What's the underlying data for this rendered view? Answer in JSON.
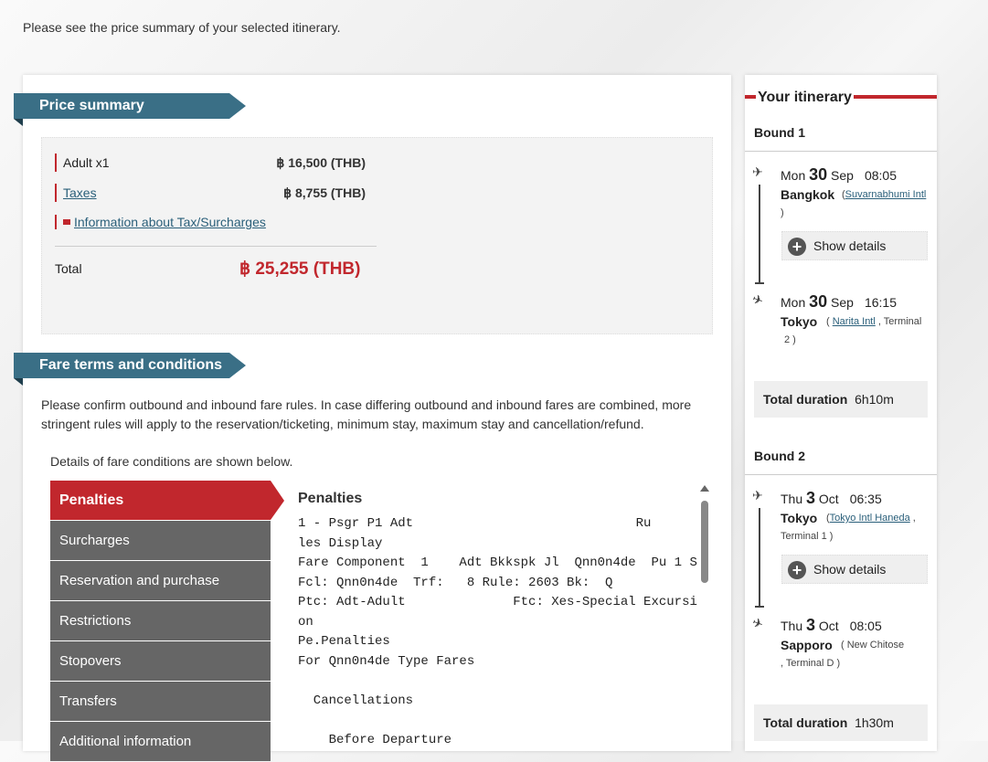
{
  "intro": "Please see the price summary of your selected itinerary.",
  "price_summary": {
    "heading": "Price summary",
    "adult_label": "Adult x1",
    "adult_amount": "฿ 16,500 (THB)",
    "taxes_label": "Taxes",
    "taxes_amount": "฿ 8,755 (THB)",
    "tax_info_link": "Information about Tax/Surcharges",
    "total_label": "Total",
    "total_amount": "฿ 25,255 (THB)"
  },
  "fare_terms": {
    "heading": "Fare terms and conditions",
    "description": "Please confirm outbound and inbound fare rules. In case differing outbound and inbound fares are combined, more stringent rules will apply to the reservation/ticketing, minimum stay, maximum stay and cancellation/refund.",
    "detail_note": "Details of fare conditions are shown below.",
    "menu": [
      "Penalties",
      "Surcharges",
      "Reservation and purchase",
      "Restrictions",
      "Stopovers",
      "Transfers",
      "Additional information"
    ],
    "content_title": "Penalties",
    "content_text": "1 - Psgr P1 Adt                             Ru\nles Display\nFare Component  1    Adt Bkkspk Jl  Qnn0n4de  Pu 1 S\nFcl: Qnn0n4de  Trf:   8 Rule: 2603 Bk:  Q\nPtc: Adt-Adult              Ftc: Xes-Special Excursi\non\nPe.Penalties\nFor Qnn0n4de Type Fares\n\n  Cancellations\n\n    Before Departure"
  },
  "itinerary": {
    "title": "Your itinerary",
    "bound1": {
      "label": "Bound 1",
      "dep_dow": "Mon",
      "dep_day": "30",
      "dep_mon": "Sep",
      "dep_time": "08:05",
      "dep_city": "Bangkok",
      "dep_airport": "Suvarnabhumi Intl",
      "dep_after": ")",
      "show_details": "Show details",
      "arr_dow": "Mon",
      "arr_day": "30",
      "arr_mon": "Sep",
      "arr_time": "16:15",
      "arr_city": "Tokyo",
      "arr_airport": "Narita Intl",
      "arr_terminal": ", Terminal",
      "arr_terminal_2": "2 )",
      "total_duration_label": "Total duration",
      "total_duration": "6h10m"
    },
    "bound2": {
      "label": "Bound 2",
      "dep_dow": "Thu",
      "dep_day": "3",
      "dep_mon": "Oct",
      "dep_time": "06:35",
      "dep_city": "Tokyo",
      "dep_airport": "Tokyo Intl Haneda",
      "dep_terminal": "Terminal   1 )",
      "show_details": "Show details",
      "arr_dow": "Thu",
      "arr_day": "3",
      "arr_mon": "Oct",
      "arr_time": "08:05",
      "arr_city": "Sapporo",
      "arr_airport": "( New Chitose",
      "arr_terminal": ", Terminal  D )",
      "total_duration_label": "Total duration",
      "total_duration": "1h30m"
    }
  },
  "colors": {
    "accent_red": "#c1272d",
    "header_teal": "#3a6f86",
    "menu_gray": "#666666"
  }
}
